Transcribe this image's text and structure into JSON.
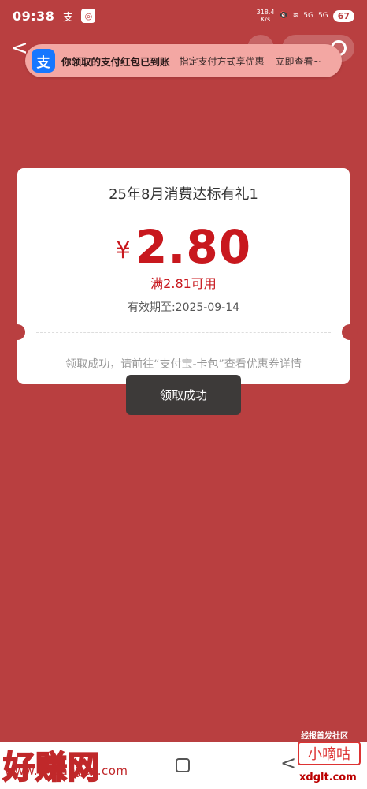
{
  "status_bar": {
    "time": "09:38",
    "app_icon_1": "支",
    "net_speed_value": "318.4",
    "net_speed_unit": "K/s",
    "signal_1": "5G",
    "signal_2": "5G",
    "battery": "67"
  },
  "header": {
    "back_icon": "back-arrow-icon"
  },
  "notification": {
    "app_icon_text": "支",
    "title": "你领取的支付红包已到账",
    "subtitle": "指定支付方式享优惠",
    "action": "立即查看~"
  },
  "coupon": {
    "title": "25年8月消费达标有礼1",
    "currency": "¥",
    "amount": "2.80",
    "threshold": "满2.81可用",
    "validity": "有效期至:2025-09-14",
    "note": "领取成功，请前往“支付宝-卡包”查看优惠券详情"
  },
  "toast": {
    "message": "领取成功"
  },
  "watermarks": {
    "community": "线报首发社区",
    "brand_big": "好赚网",
    "brand_url": "www.zhuanyes.com",
    "brand_right": "小嘀咕",
    "brand_right_url": "xdglt.com"
  },
  "colors": {
    "background": "#b93f40",
    "accent_red": "#c8181e",
    "alipay_blue": "#1677ff",
    "toast_bg": "#3d3a39"
  }
}
